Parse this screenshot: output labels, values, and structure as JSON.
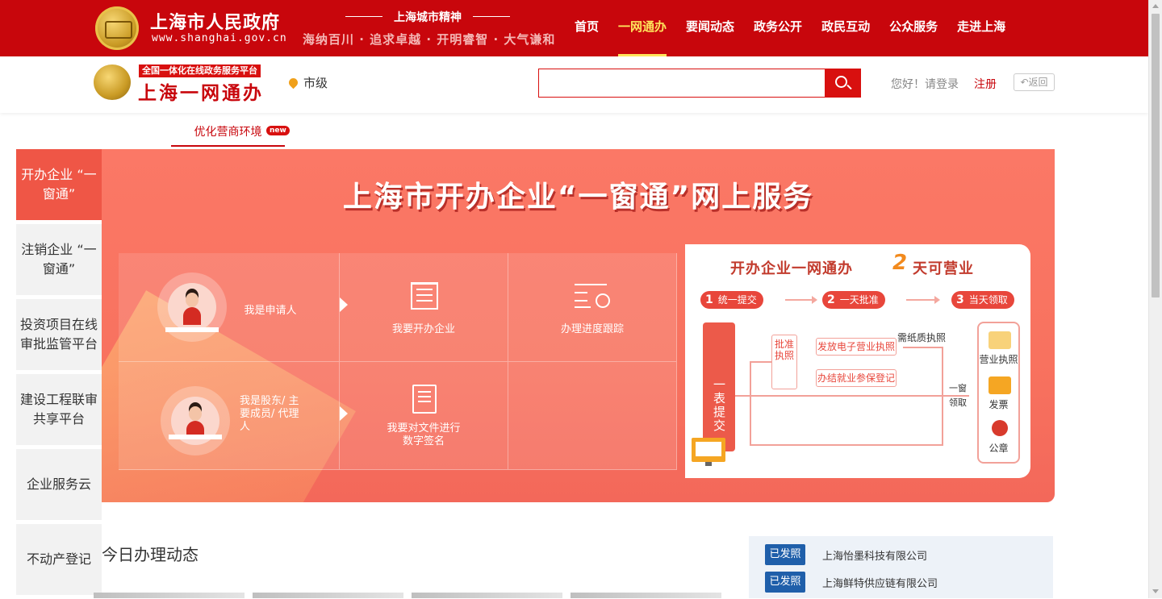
{
  "header": {
    "site_title": "上海市人民政府",
    "site_url": "www.shanghai.gov.cn",
    "spirit_title": "上海城市精神",
    "spirit_line": "海纳百川 · 追求卓越 · 开明睿智 · 大气谦和",
    "nav": [
      "首页",
      "一网通办",
      "要闻动态",
      "政务公开",
      "政民互动",
      "公众服务",
      "走进上海"
    ],
    "nav_active": "一网通办",
    "brand_red": "#c8060c"
  },
  "subheader": {
    "tag": "全国一体化在线政务服务平台",
    "title": "上海一网通办",
    "location": "市级",
    "search_placeholder": "",
    "greeting": "您好！请登录",
    "register": "注册",
    "back": "返回"
  },
  "tab": {
    "label": "优化营商环境",
    "badge": "new"
  },
  "sidebar": {
    "items": [
      {
        "label": "开办企业 “一窗通”",
        "active": true
      },
      {
        "label": "注销企业 “一窗通”",
        "active": false
      },
      {
        "label": "投资项目在线审批监管平台",
        "active": false
      },
      {
        "label": "建设工程联审共享平台",
        "active": false
      },
      {
        "label": "企业服务云",
        "active": false
      },
      {
        "label": "不动产登记",
        "active": false
      }
    ]
  },
  "banner": {
    "title": "上海市开办企业“一窗通”网上服务",
    "grid": {
      "applicant": "我是申请人",
      "shareholder": "我是股东/ 主要成员/ 代理人",
      "open_company": "我要开办企业",
      "progress": "办理进度跟踪",
      "sign": "我要对文件进行数字签名"
    },
    "card": {
      "title": "开办企业一网通办",
      "days_num": "2",
      "days_text": "天可营业",
      "steps": [
        {
          "num": "1",
          "label": "统一提交"
        },
        {
          "num": "2",
          "label": "一天批准"
        },
        {
          "num": "3",
          "label": "当天领取"
        }
      ],
      "submit": "一表提交",
      "approve": "批准执照",
      "issue_license": "发放电子营业执照",
      "social_security": "办结就业参保登记",
      "paper_license": "需纸质执照",
      "one_window": "一窗领取",
      "outputs": [
        "营业执照",
        "发票",
        "公章"
      ]
    }
  },
  "activity": {
    "title": "今日办理动态",
    "notices": [
      {
        "badge": "已发照",
        "company": "上海怡墨科技有限公司"
      },
      {
        "badge": "已发照",
        "company": "上海鲜特供应链有限公司"
      }
    ]
  }
}
